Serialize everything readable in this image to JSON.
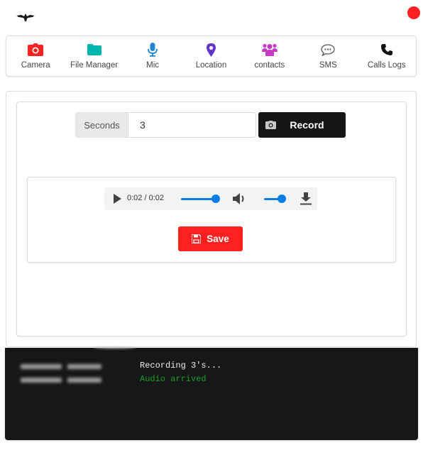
{
  "header": {
    "logo_icon": "eagle-logo-icon",
    "status_indicator_color": "#ff2020"
  },
  "nav": {
    "items": [
      {
        "label": "Camera",
        "icon": "camera-icon",
        "color": "#ff2020"
      },
      {
        "label": "File Manager",
        "icon": "folder-icon",
        "color": "#00b5ad"
      },
      {
        "label": "Mic",
        "icon": "microphone-icon",
        "color": "#2185d0"
      },
      {
        "label": "Location",
        "icon": "map-marker-icon",
        "color": "#6435c9"
      },
      {
        "label": "contacts",
        "icon": "users-icon",
        "color": "#c739c7"
      },
      {
        "label": "SMS",
        "icon": "comment-dots-icon",
        "color": "#555555"
      },
      {
        "label": "Calls Logs",
        "icon": "phone-icon",
        "color": "#111111"
      }
    ]
  },
  "recorder": {
    "seconds_label": "Seconds",
    "seconds_value": "3",
    "record_label": "Record",
    "record_icon": "camera-icon"
  },
  "audio_player": {
    "time_display": "0:02 / 0:02",
    "progress": 1.0,
    "volume": 1.0,
    "accent_color": "#0a7de6"
  },
  "save": {
    "label": "Save",
    "icon": "floppy-disk-icon",
    "color": "#ff2020"
  },
  "console": {
    "logs": [
      {
        "timestamp_blurred": true,
        "message": "Recording 3's...",
        "level": "info"
      },
      {
        "timestamp_blurred": true,
        "message": "Audio arrived",
        "level": "success"
      }
    ]
  }
}
